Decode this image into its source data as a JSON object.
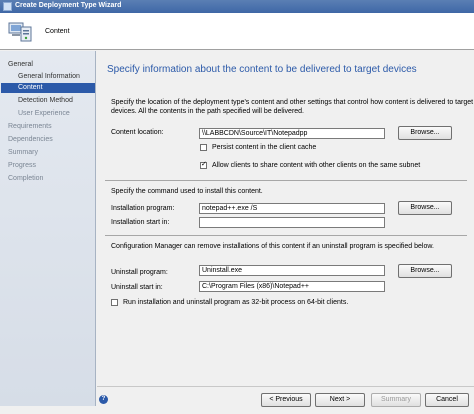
{
  "window": {
    "title": "Create Deployment Type Wizard"
  },
  "header": {
    "title": "Content"
  },
  "nav": {
    "items": [
      {
        "label": "General"
      },
      {
        "label": "General Information"
      },
      {
        "label": "Content"
      },
      {
        "label": "Detection Method"
      },
      {
        "label": "User Experience"
      },
      {
        "label": "Requirements"
      },
      {
        "label": "Dependencies"
      },
      {
        "label": "Summary"
      },
      {
        "label": "Progress"
      },
      {
        "label": "Completion"
      }
    ]
  },
  "page": {
    "heading": "Specify information about the content to be delivered to target devices",
    "description_line1": "Specify the location of the deployment type's content and other settings that control how content is delivered to target",
    "description_line2": "devices. All the contents in the path specified will be delivered.",
    "content_location_label": "Content location:",
    "content_location_value": "\\\\LABBCDN\\Source\\IT\\Notepadpp",
    "browse_label": "Browse...",
    "persist_label": "Persist content in the client cache",
    "allow_share_label": "Allow clients to share content with other clients on the same subnet",
    "command_intro": "Specify the command used to install this content.",
    "install_program_label": "Installation program:",
    "install_program_value": "notepad++.exe /S",
    "install_start_label": "Installation start in:",
    "install_start_value": "",
    "uninstall_intro": "Configuration Manager can remove installations of this content if an uninstall program is specified below.",
    "uninstall_program_label": "Uninstall program:",
    "uninstall_program_value": "Uninstall.exe",
    "uninstall_start_label": "Uninstall start in:",
    "uninstall_start_value": "C:\\Program Files (x86)\\Notepad++",
    "run32_label": "Run installation and uninstall program as 32-bit process on 64-bit clients."
  },
  "checkbox_states": {
    "persist": false,
    "allow_share": true,
    "run32": false
  },
  "footer": {
    "help_glyph": "?",
    "previous_label": "< Previous",
    "next_label": "Next >",
    "summary_label": "Summary",
    "cancel_label": "Cancel"
  }
}
